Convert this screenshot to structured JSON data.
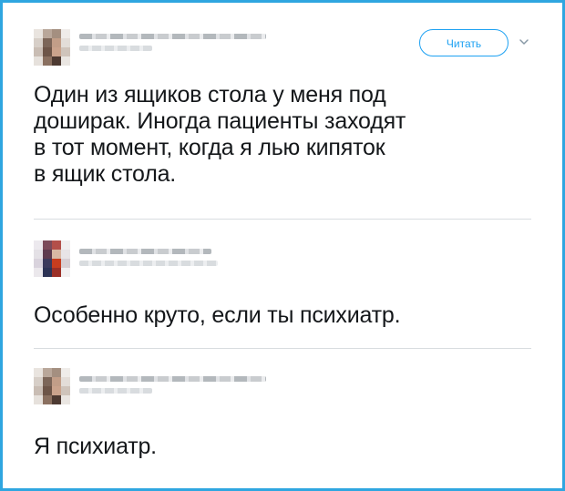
{
  "header": {
    "follow_label": "Читать",
    "menu_icon": "chevron-down-icon"
  },
  "tweets": [
    {
      "author_name": "",
      "author_handle": "",
      "text": "Один из ящиков стола у меня под\nдоширак. Иногда пациенты заходят\nв тот момент, когда я лью кипяток\nв ящик стола."
    },
    {
      "author_name": "",
      "author_handle": "",
      "text": "Особенно круто, если ты психиатр."
    },
    {
      "author_name": "",
      "author_handle": "",
      "text": "Я психиатр."
    }
  ],
  "colors": {
    "frame_border": "#2fa6e0",
    "accent": "#1da1f2",
    "text": "#14171a",
    "divider": "#d9dde0"
  }
}
